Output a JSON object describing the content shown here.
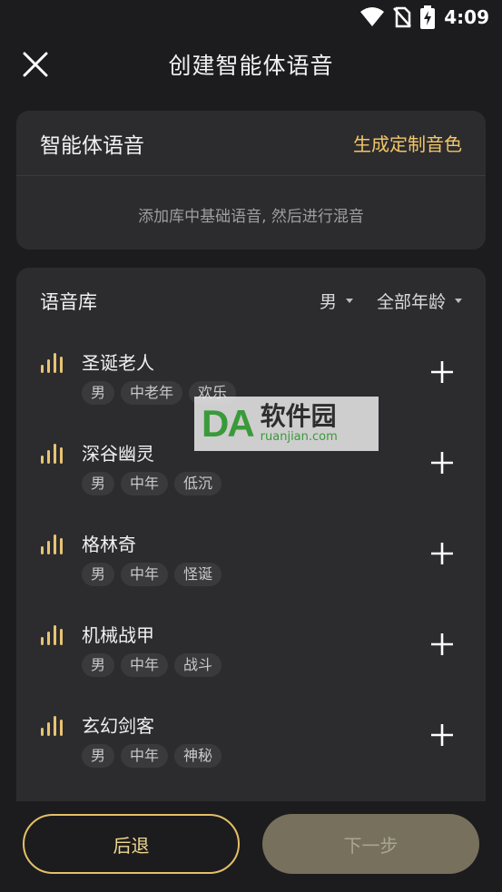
{
  "status_bar": {
    "time": "4:09"
  },
  "header": {
    "title": "创建智能体语音",
    "close_icon": "close-icon"
  },
  "voice_card": {
    "heading": "智能体语音",
    "generate_link": "生成定制音色",
    "hint": "添加库中基础语音, 然后进行混音"
  },
  "library": {
    "title": "语音库",
    "gender_filter": "男",
    "age_filter": "全部年龄",
    "items": [
      {
        "name": "圣诞老人",
        "tags": [
          "男",
          "中老年",
          "欢乐"
        ]
      },
      {
        "name": "深谷幽灵",
        "tags": [
          "男",
          "中年",
          "低沉"
        ]
      },
      {
        "name": "格林奇",
        "tags": [
          "男",
          "中年",
          "怪诞"
        ]
      },
      {
        "name": "机械战甲",
        "tags": [
          "男",
          "中年",
          "战斗"
        ]
      },
      {
        "name": "玄幻剑客",
        "tags": [
          "男",
          "中年",
          "神秘"
        ]
      }
    ]
  },
  "watermark": {
    "logo": "DA",
    "text": "软件园",
    "url": "ruanjian.com"
  },
  "buttons": {
    "back": "后退",
    "next": "下一步"
  },
  "colors": {
    "accent": "#f2c668",
    "background": "#1c1c1e",
    "card": "#2c2c2e",
    "next_disabled": "#77705c"
  }
}
